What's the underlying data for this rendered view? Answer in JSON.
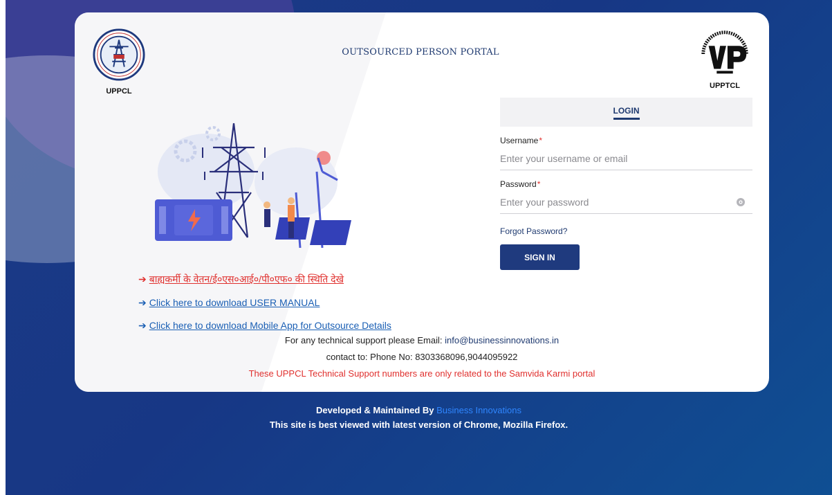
{
  "header": {
    "portal_title": "OUTSOURCED PERSON PORTAL",
    "left_logo_caption": "UPPCL",
    "right_logo_caption": "UPPTCL"
  },
  "login": {
    "tab_label": "LOGIN",
    "username_label": "Username",
    "username_placeholder": "Enter your username or email",
    "password_label": "Password",
    "password_placeholder": "Enter your password",
    "required_mark": "*",
    "forgot_label": "Forgot Password?",
    "signin_label": "SIGN IN"
  },
  "links": [
    {
      "text": "बाह्यकर्मी के वेतन/ई०एस०आई०/पी०एफ० की स्थिति देखे",
      "color": "#e0302e"
    },
    {
      "text": "Click here to download USER MANUAL",
      "color": "#1a5fb4"
    },
    {
      "text": "Click here to download Mobile App for Outsource Details",
      "color": "#1a5fb4"
    }
  ],
  "support": {
    "email_prefix": "For any technical support please Email: ",
    "email": "info@businessinnovations.in",
    "phone_line": "contact to: Phone No: 8303368096,9044095922",
    "notice": "These UPPCL Technical Support numbers are only related to the Samvida Karmi portal"
  },
  "footer": {
    "developed_prefix": "Developed & Maintained By ",
    "brand": "Business Innovations",
    "browser_note": "This site is best viewed with latest version of Chrome, Mozilla Firefox."
  },
  "icons": {
    "link_arrow": "arrow-right-icon",
    "password_toggle": "eye-icon"
  },
  "colors": {
    "primary": "#1f3a7e",
    "accent_red": "#e0302e",
    "link_blue": "#1a5fb4",
    "brand_blue": "#2f86ff"
  }
}
